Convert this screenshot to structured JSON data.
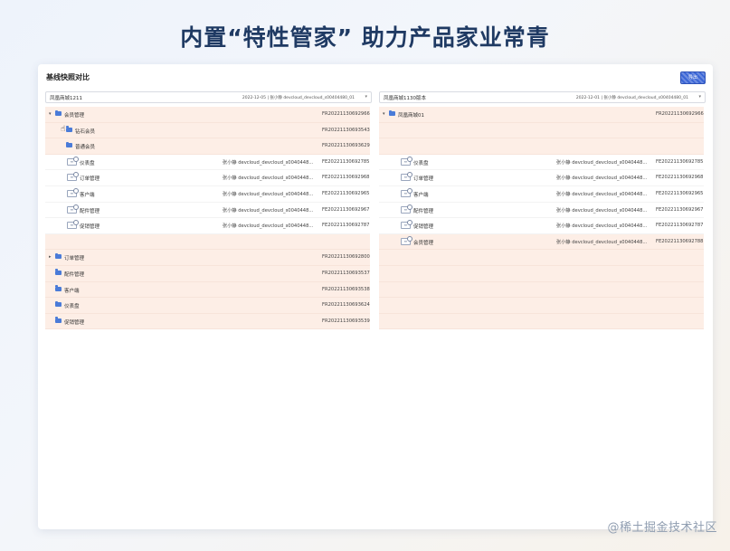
{
  "slide": {
    "title": "内置“特性管家” 助力产品家业常青",
    "watermark": "@稀土掘金技术社区"
  },
  "card": {
    "title": "基线快照对比",
    "export_label": "导出"
  },
  "left_select": {
    "name": "凤凰商城1211",
    "info": "2022-12-05 | 张小静 devcloud_devcloud_s00404480_01"
  },
  "right_select": {
    "name": "凤凰商城1130版本",
    "info": "2022-12-01 | 张小静 devcloud_devcloud_s00404480_01"
  },
  "left_rows": [
    {
      "kind": "folder",
      "caret": "▾",
      "name": "会员管理",
      "author": "",
      "code": "FR20221130692966",
      "hl": true,
      "level": 0
    },
    {
      "kind": "folder",
      "caret": "",
      "name": "钻石会员",
      "author": "",
      "code": "FR20221130693543",
      "hl": true,
      "level": 1,
      "cursor": true
    },
    {
      "kind": "folder",
      "caret": "",
      "name": "普通会员",
      "author": "",
      "code": "FR20221130693629",
      "hl": true,
      "level": 1
    },
    {
      "kind": "feature",
      "caret": "",
      "name": "仪表盘",
      "author": "张小静 devcloud_devcloud_s0040448...",
      "code": "FE20221130692785",
      "hl": false,
      "level": 1
    },
    {
      "kind": "feature",
      "caret": "",
      "name": "订单管理",
      "author": "张小静 devcloud_devcloud_s0040448...",
      "code": "FE20221130692968",
      "hl": false,
      "level": 1
    },
    {
      "kind": "feature",
      "caret": "",
      "name": "客户端",
      "author": "张小静 devcloud_devcloud_s0040448...",
      "code": "FE20221130692965",
      "hl": false,
      "level": 1
    },
    {
      "kind": "feature",
      "caret": "",
      "name": "配件管理",
      "author": "张小静 devcloud_devcloud_s0040448...",
      "code": "FE20221130692967",
      "hl": false,
      "level": 1
    },
    {
      "kind": "feature",
      "caret": "",
      "name": "促销管理",
      "author": "张小静 devcloud_devcloud_s0040448...",
      "code": "FE20221130692787",
      "hl": false,
      "level": 1
    },
    {
      "kind": "empty",
      "hl": true
    },
    {
      "kind": "folder",
      "caret": "▸",
      "name": "订单管理",
      "author": "",
      "code": "FR20221130692800",
      "hl": true,
      "level": 0
    },
    {
      "kind": "folder",
      "caret": "",
      "name": "配件管理",
      "author": "",
      "code": "FR20221130693537",
      "hl": true,
      "level": 0
    },
    {
      "kind": "folder",
      "caret": "",
      "name": "客户端",
      "author": "",
      "code": "FR20221130693538",
      "hl": true,
      "level": 0
    },
    {
      "kind": "folder",
      "caret": "",
      "name": "仪表盘",
      "author": "",
      "code": "FR20221130693624",
      "hl": true,
      "level": 0
    },
    {
      "kind": "folder",
      "caret": "",
      "name": "促销管理",
      "author": "",
      "code": "FR20221130693539",
      "hl": true,
      "level": 0
    }
  ],
  "right_rows": [
    {
      "kind": "folder",
      "caret": "▾",
      "name": "凤凰商城01",
      "author": "",
      "code": "FR20221130692966",
      "hl": true,
      "level": 0
    },
    {
      "kind": "empty",
      "hl": true
    },
    {
      "kind": "empty",
      "hl": true
    },
    {
      "kind": "feature",
      "caret": "",
      "name": "仪表盘",
      "author": "张小静 devcloud_devcloud_s0040448...",
      "code": "FE20221130692785",
      "hl": false,
      "level": 1
    },
    {
      "kind": "feature",
      "caret": "",
      "name": "订单管理",
      "author": "张小静 devcloud_devcloud_s0040448...",
      "code": "FE20221130692968",
      "hl": false,
      "level": 1
    },
    {
      "kind": "feature",
      "caret": "",
      "name": "客户端",
      "author": "张小静 devcloud_devcloud_s0040448...",
      "code": "FE20221130692965",
      "hl": false,
      "level": 1
    },
    {
      "kind": "feature",
      "caret": "",
      "name": "配件管理",
      "author": "张小静 devcloud_devcloud_s0040448...",
      "code": "FE20221130692967",
      "hl": false,
      "level": 1
    },
    {
      "kind": "feature",
      "caret": "",
      "name": "促销管理",
      "author": "张小静 devcloud_devcloud_s0040448...",
      "code": "FE20221130692787",
      "hl": false,
      "level": 1
    },
    {
      "kind": "feature",
      "caret": "",
      "name": "会员管理",
      "author": "张小静 devcloud_devcloud_s0040448...",
      "code": "FE20221130692788",
      "hl": true,
      "level": 1
    },
    {
      "kind": "empty",
      "hl": true
    },
    {
      "kind": "empty",
      "hl": true
    },
    {
      "kind": "empty",
      "hl": true
    },
    {
      "kind": "empty",
      "hl": true
    },
    {
      "kind": "empty",
      "hl": true
    }
  ]
}
